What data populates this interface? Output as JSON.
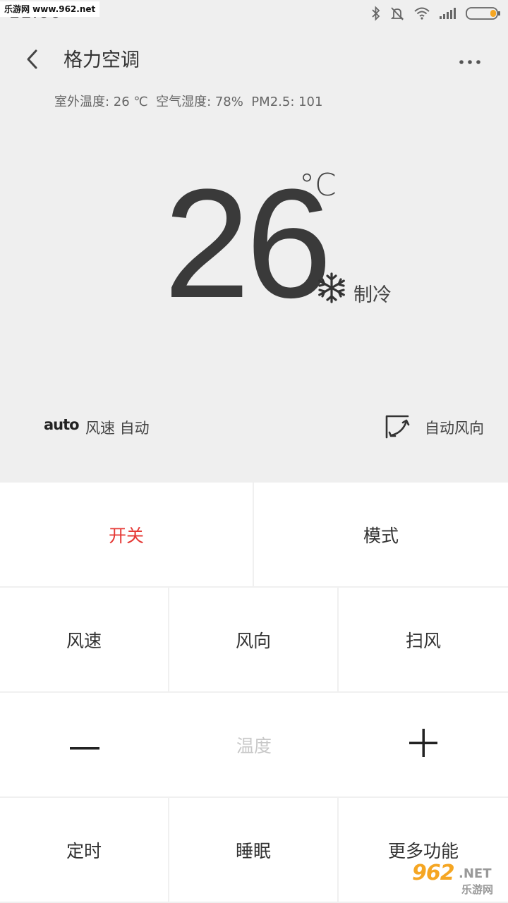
{
  "watermark": {
    "top_text": "乐游网 www.962.net",
    "bottom_num": "962",
    "bottom_net": ".NET",
    "bottom_cn": "乐游网"
  },
  "status_bar": {
    "time": "11:00",
    "icons": [
      "bluetooth-icon",
      "mute-icon",
      "wifi-icon",
      "signal-icon",
      "battery-icon"
    ]
  },
  "header": {
    "title": "格力空调",
    "back_icon": "chevron-left-icon",
    "more_icon": "more-horizontal-icon"
  },
  "env": {
    "text": "室外温度: 26 ℃  空气湿度: 78%  PM2.5: 101"
  },
  "thermostat": {
    "temperature": "26",
    "unit": "°C",
    "mode_icon": "snowflake-icon",
    "mode": "制冷"
  },
  "fan": {
    "badge": "auto",
    "speed_text": "风速 自动"
  },
  "direction": {
    "icon": "swing-direction-icon",
    "text": "自动风向"
  },
  "controls": {
    "power": "开关",
    "mode": "模式",
    "fan_speed": "风速",
    "fan_direction": "风向",
    "swing": "扫风",
    "temp_minus_icon": "minus-icon",
    "temp_label": "温度",
    "temp_plus_icon": "plus-icon",
    "timer": "定时",
    "sleep": "睡眠",
    "more": "更多功能"
  },
  "colors": {
    "accent_red": "#e53935",
    "top_background": "#efefef"
  }
}
